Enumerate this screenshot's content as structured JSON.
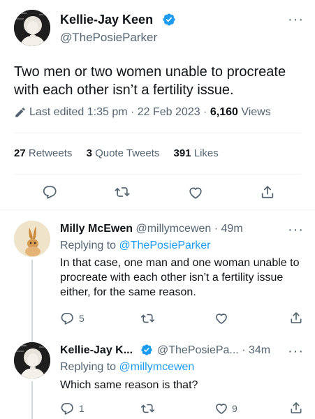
{
  "main_tweet": {
    "author_name": "Kellie-Jay Keen",
    "handle": "@ThePosieParker",
    "text": "Two men or two women unable to procreate with each other isn’t a fertility issue.",
    "edited_label": "Last edited 1:35 pm · 22 Feb 2023 ·",
    "views_count": "6,160",
    "views_label": "Views",
    "retweets_count": "27",
    "retweets_label": "Retweets",
    "quotes_count": "3",
    "quotes_label": "Quote Tweets",
    "likes_count": "391",
    "likes_label": "Likes"
  },
  "reply1": {
    "author_name": "Milly McEwen",
    "handle": "@millymcewen",
    "time": "· 49m",
    "replying_prefix": "Replying to",
    "replying_to": "@ThePosieParker",
    "text": "In that case, one man and one woman unable to procreate with each other isn’t a fertility issue either, for the same reason.",
    "reply_count": "5"
  },
  "reply2": {
    "author_name": "Kellie-Jay K...",
    "handle": "@ThePosiePa...",
    "time": "· 34m",
    "replying_prefix": "Replying to",
    "replying_to": "@millymcewen",
    "text": "Which same reason is that?",
    "reply_count": "1",
    "like_count": "9"
  },
  "colors": {
    "accent": "#1d9bf0",
    "secondary_text": "#536471",
    "divider": "#eff3f4"
  },
  "icons": [
    "verified-badge-icon",
    "more-icon",
    "pencil-icon",
    "reply-icon",
    "retweet-icon",
    "like-icon",
    "share-icon"
  ]
}
